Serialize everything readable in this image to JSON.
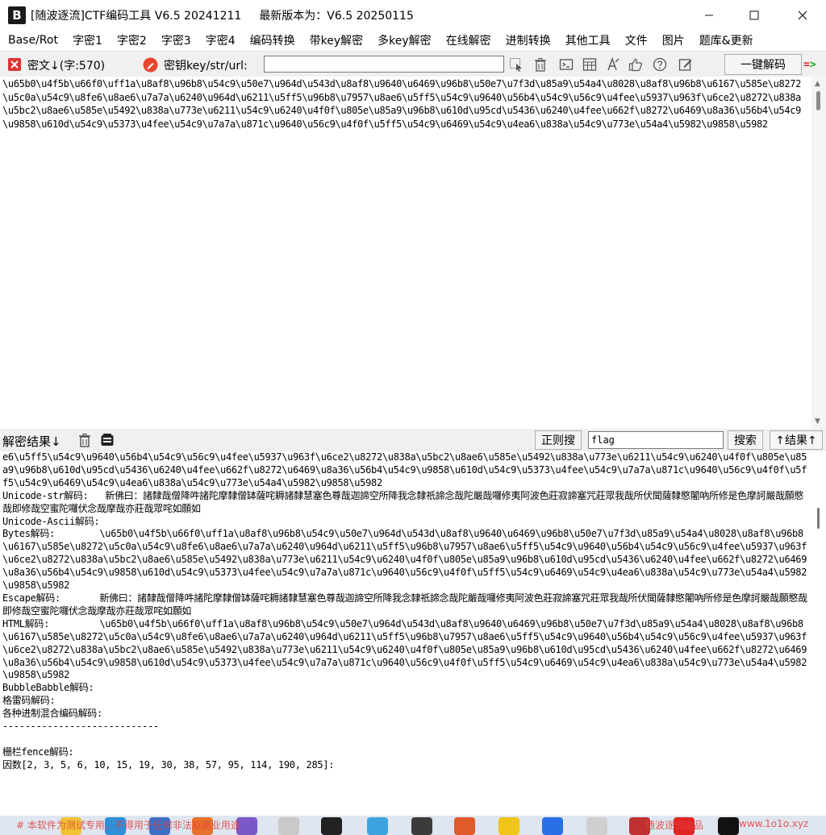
{
  "window": {
    "title": "[随波逐流]CTF编码工具 V6.5 20241211",
    "latest_version": "最新版本为：V6.5 20250115",
    "app_icon_letter": "B"
  },
  "menu": [
    "Base/Rot",
    "字密1",
    "字密2",
    "字密3",
    "字密4",
    "编码转换",
    "带key解密",
    "多key解密",
    "在线解密",
    "进制转换",
    "其他工具",
    "文件",
    "图片",
    "题库&更新"
  ],
  "toolbar": {
    "cipher_label": "密文↓(字:570)",
    "key_label": "密钥key/str/url:",
    "key_value": "",
    "decode_button": "一键解码",
    "go_arrow": "=>"
  },
  "ciphertext": "\\u65b0\\u4f5b\\u66f0\\uff1a\\u8af8\\u96b8\\u54c9\\u50e7\\u964d\\u543d\\u8af8\\u9640\\u6469\\u96b8\\u50e7\\u7f3d\\u85a9\\u54a4\\u8028\\u8af8\\u96b8\\u6167\\u585e\\u8272\\u5c0a\\u54c9\\u8fe6\\u8ae6\\u7a7a\\u6240\\u964d\\u6211\\u5ff5\\u96b8\\u7957\\u8ae6\\u5ff5\\u54c9\\u9640\\u56b4\\u54c9\\u56c9\\u4fee\\u5937\\u963f\\u6ce2\\u8272\\u838a\\u5bc2\\u8ae6\\u585e\\u5492\\u838a\\u773e\\u6211\\u54c9\\u6240\\u4f0f\\u805e\\u85a9\\u96b8\\u610d\\u95cd\\u5436\\u6240\\u4fee\\u662f\\u8272\\u6469\\u8a36\\u56b4\\u54c9\\u9858\\u610d\\u54c9\\u5373\\u4fee\\u54c9\\u7a7a\\u871c\\u9640\\u56c9\\u4f0f\\u5ff5\\u54c9\\u6469\\u54c9\\u4ea6\\u838a\\u54c9\\u773e\\u54a4\\u5982\\u9858\\u5982",
  "resultbar": {
    "label": "解密结果↓",
    "regex_button": "正则搜",
    "search_value": "flag",
    "search_button": "搜索",
    "result_up_button": "↑结果↑"
  },
  "results": "e6\\u5ff5\\u54c9\\u9640\\u56b4\\u54c9\\u56c9\\u4fee\\u5937\\u963f\\u6ce2\\u8272\\u838a\\u5bc2\\u8ae6\\u585e\\u5492\\u838a\\u773e\\u6211\\u54c9\\u6240\\u4f0f\\u805e\\u85a9\\u96b8\\u610d\\u95cd\\u5436\\u6240\\u4fee\\u662f\\u8272\\u6469\\u8a36\\u56b4\\u54c9\\u9858\\u610d\\u54c9\\u5373\\u4fee\\u54c9\\u7a7a\\u871c\\u9640\\u56c9\\u4f0f\\u5ff5\\u54c9\\u6469\\u54c9\\u4ea6\\u838a\\u54c9\\u773e\\u54a4\\u5982\\u9858\\u5982\nUnicode-str解码:   新佛曰：諸隸哉僧降吽諸陀摩隸僧缽薩咤耨諸隸慧塞色尊哉迦諦空所降我念隸祇諦念哉陀嚴哉囉修夷阿波色莊寂諦塞咒莊眾我哉所伏聞薩隸愍闍吶所修是色摩訶嚴哉願愍哉即修哉空蜜陀囉伏念哉摩哉亦莊哉眾咤如願如\nUnicode-Ascii解码:\nBytes解码:        \\u65b0\\u4f5b\\u66f0\\uff1a\\u8af8\\u96b8\\u54c9\\u50e7\\u964d\\u543d\\u8af8\\u9640\\u6469\\u96b8\\u50e7\\u7f3d\\u85a9\\u54a4\\u8028\\u8af8\\u96b8\\u6167\\u585e\\u8272\\u5c0a\\u54c9\\u8fe6\\u8ae6\\u7a7a\\u6240\\u964d\\u6211\\u5ff5\\u96b8\\u7957\\u8ae6\\u5ff5\\u54c9\\u9640\\u56b4\\u54c9\\u56c9\\u4fee\\u5937\\u963f\\u6ce2\\u8272\\u838a\\u5bc2\\u8ae6\\u585e\\u5492\\u838a\\u773e\\u6211\\u54c9\\u6240\\u4f0f\\u805e\\u85a9\\u96b8\\u610d\\u95cd\\u5436\\u6240\\u4fee\\u662f\\u8272\\u6469\\u8a36\\u56b4\\u54c9\\u9858\\u610d\\u54c9\\u5373\\u4fee\\u54c9\\u7a7a\\u871c\\u9640\\u56c9\\u4f0f\\u5ff5\\u54c9\\u6469\\u54c9\\u4ea6\\u838a\\u54c9\\u773e\\u54a4\\u5982\\u9858\\u5982\nEscape解码:       新佛曰：諸隸哉僧降吽諸陀摩隸僧缽薩咤耨諸隸慧塞色尊哉迦諦空所降我念隸祇諦念哉陀嚴哉囉修夷阿波色莊寂諦塞咒莊眾我哉所伏聞薩隸愍闍吶所修是色摩訶嚴哉願愍哉即修哉空蜜陀囉伏念哉摩哉亦莊哉眾咤如願如\nHTML解码:         \\u65b0\\u4f5b\\u66f0\\uff1a\\u8af8\\u96b8\\u54c9\\u50e7\\u964d\\u543d\\u8af8\\u9640\\u6469\\u96b8\\u50e7\\u7f3d\\u85a9\\u54a4\\u8028\\u8af8\\u96b8\\u6167\\u585e\\u8272\\u5c0a\\u54c9\\u8fe6\\u8ae6\\u7a7a\\u6240\\u964d\\u6211\\u5ff5\\u96b8\\u7957\\u8ae6\\u5ff5\\u54c9\\u9640\\u56b4\\u54c9\\u56c9\\u4fee\\u5937\\u963f\\u6ce2\\u8272\\u838a\\u5bc2\\u8ae6\\u585e\\u5492\\u838a\\u773e\\u6211\\u54c9\\u6240\\u4f0f\\u805e\\u85a9\\u96b8\\u610d\\u95cd\\u5436\\u6240\\u4fee\\u662f\\u8272\\u6469\\u8a36\\u56b4\\u54c9\\u9858\\u610d\\u54c9\\u5373\\u4fee\\u54c9\\u7a7a\\u871c\\u9640\\u56c9\\u4f0f\\u5ff5\\u54c9\\u6469\\u54c9\\u4ea6\\u838a\\u54c9\\u773e\\u54a4\\u5982\\u9858\\u5982\nBubbleBabble解码:\n格雷码解码:\n各种进制混合编码解码:\n----------------------------\n\n栅栏fence解码:\n因数[2, 3, 5, 6, 10, 15, 19, 30, 38, 57, 95, 114, 190, 285]:",
  "taskbar": {
    "watermark_left": "# 本软件为测试专用，不得用于任何非法及商业用途",
    "watermark_mid": "随波逐流出品",
    "watermark_right": "www.1o1o.xyz"
  }
}
